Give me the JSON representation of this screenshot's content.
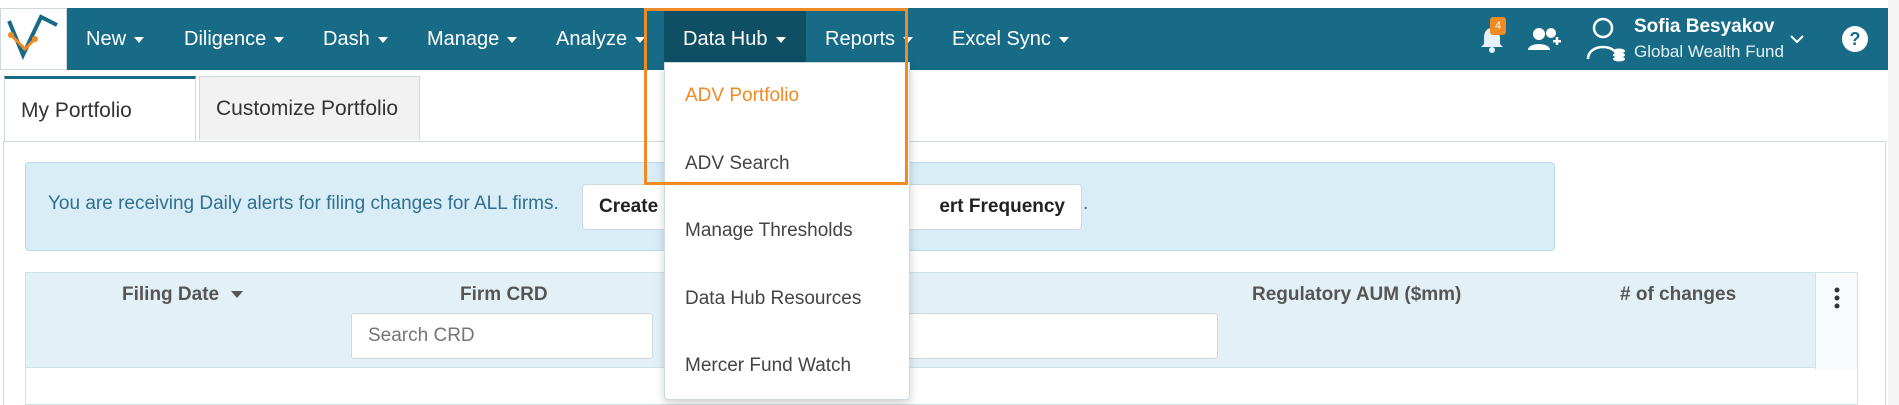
{
  "nav": {
    "items": [
      {
        "label": "New"
      },
      {
        "label": "Diligence"
      },
      {
        "label": "Dash"
      },
      {
        "label": "Manage"
      },
      {
        "label": "Analyze"
      },
      {
        "label": "Data Hub"
      },
      {
        "label": "Reports"
      },
      {
        "label": "Excel Sync"
      }
    ],
    "notification_count": "4",
    "user_name": "Sofia Besyakov",
    "user_fund": "Global Wealth Fund",
    "help_label": "?"
  },
  "tabs": [
    {
      "label": "My Portfolio"
    },
    {
      "label": "Customize Portfolio"
    }
  ],
  "alert": {
    "text": "You are receiving Daily alerts for filing changes for ALL firms.",
    "create_button": "Create",
    "frequency_button": "ert Frequency",
    "trailing": "."
  },
  "grid": {
    "columns": [
      {
        "label": "Filing Date"
      },
      {
        "label": "Firm CRD"
      },
      {
        "label": "Regulatory AUM ($mm)"
      },
      {
        "label": "# of changes"
      }
    ],
    "crd_placeholder": "Search CRD"
  },
  "dropdown": {
    "items": [
      {
        "label": "ADV Portfolio"
      },
      {
        "label": "ADV Search"
      },
      {
        "label": "Manage Thresholds"
      },
      {
        "label": "Data Hub Resources"
      },
      {
        "label": "Mercer Fund Watch"
      }
    ]
  },
  "colors": {
    "nav_bg": "#176b87",
    "nav_active": "#0f4f63",
    "accent_orange": "#f08a24",
    "alert_bg": "#d9edf7"
  }
}
